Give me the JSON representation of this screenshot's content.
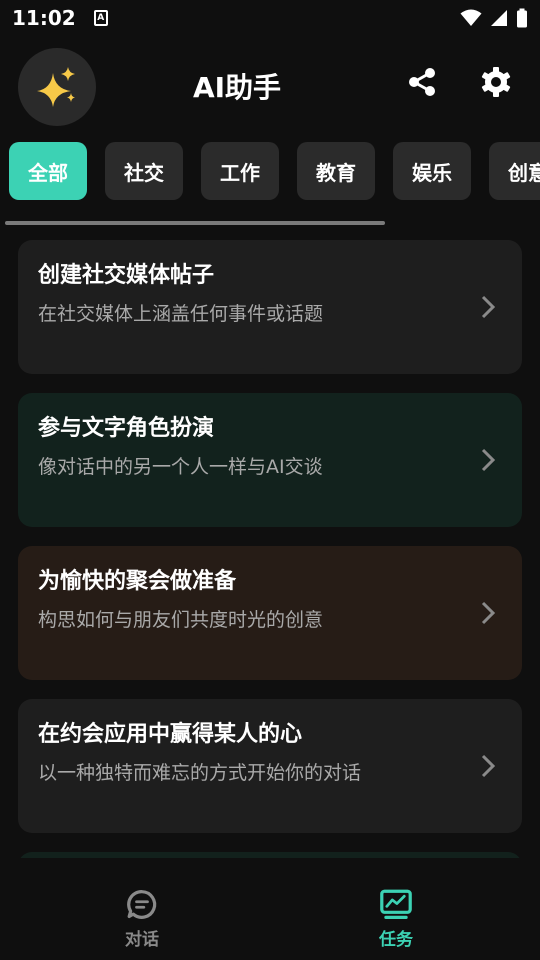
{
  "status_bar": {
    "time": "11:02",
    "notification_letter": "A"
  },
  "header": {
    "title": "AI助手",
    "logo_icon": "sparkles-icon",
    "share_icon": "share-icon",
    "settings_icon": "gear-icon"
  },
  "tabs": [
    {
      "label": "全部",
      "active": true
    },
    {
      "label": "社交",
      "active": false
    },
    {
      "label": "工作",
      "active": false
    },
    {
      "label": "教育",
      "active": false
    },
    {
      "label": "娱乐",
      "active": false
    },
    {
      "label": "创意",
      "active": false
    }
  ],
  "tasks": [
    {
      "title": "创建社交媒体帖子",
      "description": "在社交媒体上涵盖任何事件或话题",
      "background": "#1e1e1e"
    },
    {
      "title": "参与文字角色扮演",
      "description": "像对话中的另一个人一样与AI交谈",
      "background": "#12221d"
    },
    {
      "title": "为愉快的聚会做准备",
      "description": "构思如何与朋友们共度时光的创意",
      "background": "#261c16"
    },
    {
      "title": "在约会应用中赢得某人的心",
      "description": "以一种独特而难忘的方式开始你的对话",
      "background": "#1e1e1e"
    }
  ],
  "bottom_nav": {
    "chat_label": "对话",
    "tasks_label": "任务",
    "active": "tasks",
    "active_color": "#3cd2b4",
    "inactive_color": "#8a8a8a"
  }
}
